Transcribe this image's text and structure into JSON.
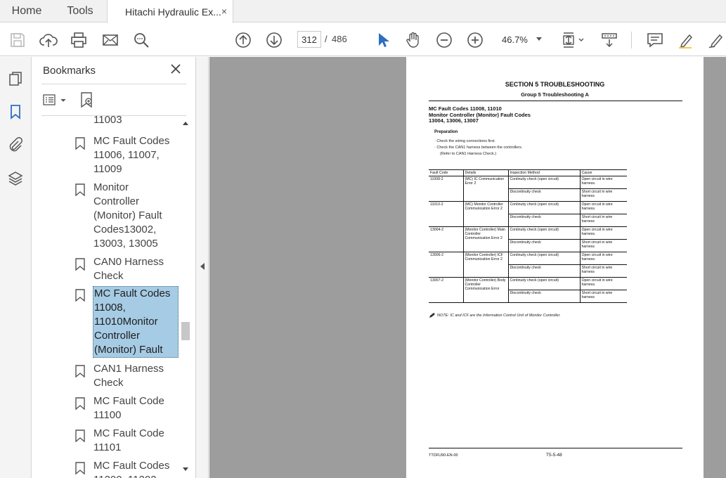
{
  "tabs": {
    "home": "Home",
    "tools": "Tools",
    "document": "Hitachi Hydraulic Ex...",
    "close": "×"
  },
  "toolbar": {
    "page_current": "312",
    "page_separator": "/",
    "page_total": "486",
    "zoom": "46.7%"
  },
  "bookmarks": {
    "title": "Bookmarks",
    "items": [
      {
        "label": "11003"
      },
      {
        "label": "MC Fault Codes\n11006, 11007,\n11009"
      },
      {
        "label": "Monitor\nController\n(Monitor) Fault\nCodes13002,\n13003, 13005"
      },
      {
        "label": "CAN0 Harness\nCheck"
      },
      {
        "label": "MC Fault Codes\n11008,\n11010Monitor\nController\n(Monitor) Fault",
        "selected": true
      },
      {
        "label": "CAN1 Harness\nCheck"
      },
      {
        "label": "MC Fault Code\n11100"
      },
      {
        "label": "MC Fault Code\n11101"
      },
      {
        "label": "MC Fault Codes\n11200, 11202"
      }
    ]
  },
  "page": {
    "section_title": "SECTION 5 TROUBLESHOOTING",
    "group_title": "Group 5 Troubleshooting A",
    "heading_1": "MC Fault Codes 11008, 11010",
    "heading_2": "Monitor Controller (Monitor) Fault Codes",
    "heading_3": "13004, 13006, 13007",
    "preparation_title": "Preparation",
    "preparation_1": "·  Check the wiring connections first.",
    "preparation_2": "·  Check the CAN1 harness between the controllers.",
    "preparation_3": "(Refer to CAN1 Harness Check.)",
    "table": {
      "headers": [
        "Fault Code",
        "Details",
        "Inspection Method",
        "Cause"
      ],
      "rows": [
        {
          "code": "11008-2",
          "details": "(MC) IC Communication Error 2",
          "checks": [
            {
              "method": "Continuity check (open circuit)",
              "cause": "Open circuit in wire harness."
            },
            {
              "method": "Discontinuity check",
              "cause": "Short circuit in wire harness"
            }
          ]
        },
        {
          "code": "11010-2",
          "details": "(MC) Monitor Controller Communication Error 2",
          "checks": [
            {
              "method": "Continuity check (open circuit)",
              "cause": "Open circuit in wire harness."
            },
            {
              "method": "Discontinuity check",
              "cause": "Short circuit in wire harness"
            }
          ]
        },
        {
          "code": "13004-2",
          "details": "(Monitor Controller) Main Controller Communication Error 2",
          "checks": [
            {
              "method": "Continuity check (open circuit)",
              "cause": "Open circuit in wire harness."
            },
            {
              "method": "Discontinuity check",
              "cause": "Short circuit in wire harness"
            }
          ]
        },
        {
          "code": "13006-2",
          "details": "(Monitor Controller) ICF Communication Error 2",
          "checks": [
            {
              "method": "Continuity check (open circuit)",
              "cause": "Open circuit in wire harness."
            },
            {
              "method": "Discontinuity check",
              "cause": "Short circuit in wire harness"
            }
          ]
        },
        {
          "code": "13007-2",
          "details": "(Monitor Controller) Body Controller Communication Error",
          "checks": [
            {
              "method": "Continuity check (open circuit)",
              "cause": "Open circuit in wire harness."
            },
            {
              "method": "Discontinuity check",
              "cause": "Short circuit in wire harness"
            }
          ]
        }
      ]
    },
    "note": "NOTE:   IC and ICF are the Information Control Unit of Monitor Controller.",
    "footer_left": "TTDFU90-EN-00",
    "footer_mid": "T5-5-48"
  },
  "colors": {
    "accent_blue": "#2e6ec1",
    "selection": "#a6cbe4",
    "canvas_gray": "#9d9d9d"
  },
  "icons": {
    "toolbar": [
      "save-icon",
      "upload-icon",
      "print-icon",
      "email-icon",
      "find-icon",
      "page-up-icon",
      "page-down-icon",
      "select-cursor-icon",
      "hand-icon",
      "zoom-out-icon",
      "zoom-in-icon",
      "fit-page-icon",
      "scroll-mode-icon",
      "comment-icon",
      "highlight-icon",
      "sign-icon"
    ],
    "rail": [
      "thumbnails-icon",
      "bookmarks-icon",
      "attachments-icon",
      "layers-icon"
    ]
  }
}
